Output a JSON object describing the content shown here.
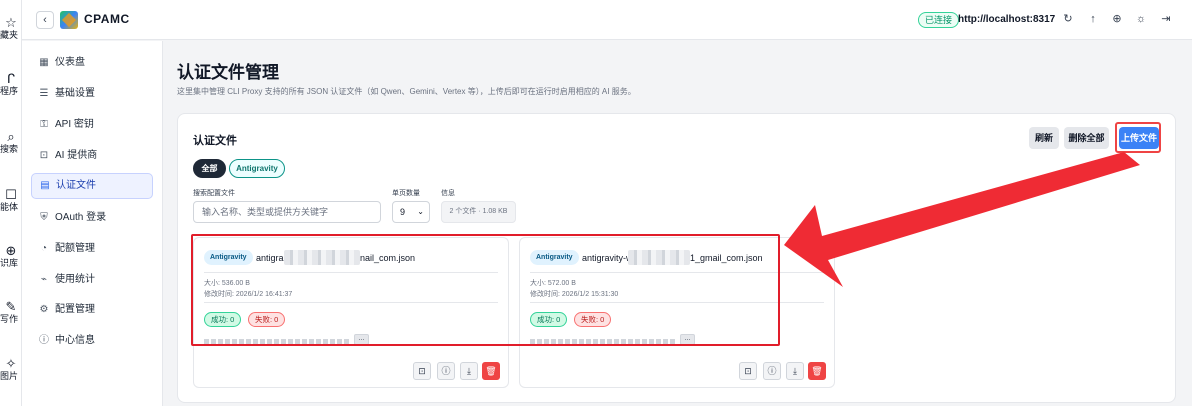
{
  "rail": [
    {
      "icon": "star-icon",
      "glyph": "☆",
      "label": "藏夹"
    },
    {
      "icon": "path-icon",
      "glyph": "ᒋ",
      "label": "程序"
    },
    {
      "icon": "search-icon",
      "glyph": "⌕",
      "label": "搜索"
    },
    {
      "icon": "robot-icon",
      "glyph": "☐",
      "label": "能体"
    },
    {
      "icon": "plus-circle-icon",
      "glyph": "⊕",
      "label": "识库"
    },
    {
      "icon": "pen-icon",
      "glyph": "✎",
      "label": "写作"
    },
    {
      "icon": "sparkle-icon",
      "glyph": "✧",
      "label": "图片"
    }
  ],
  "header": {
    "back_glyph": "‹",
    "app_name": "CPAMC",
    "status": "已连接",
    "url": "http://localhost:8317",
    "icons": [
      {
        "name": "refresh-icon",
        "glyph": "↻"
      },
      {
        "name": "upload-icon",
        "glyph": "↑"
      },
      {
        "name": "globe-icon",
        "glyph": "⊕"
      },
      {
        "name": "theme-sun-icon",
        "glyph": "☼"
      },
      {
        "name": "logout-icon",
        "glyph": "⇥"
      }
    ]
  },
  "sidebar": {
    "items": [
      {
        "label": "仪表盘",
        "glyph": "▦",
        "icon": "dashboard-icon"
      },
      {
        "label": "基础设置",
        "glyph": "☰",
        "icon": "sliders-icon"
      },
      {
        "label": "API 密钥",
        "glyph": "⚿",
        "icon": "key-icon"
      },
      {
        "label": "AI 提供商",
        "glyph": "⊡",
        "icon": "bot-icon"
      },
      {
        "label": "认证文件",
        "glyph": "▤",
        "icon": "file-icon"
      },
      {
        "label": "OAuth 登录",
        "glyph": "⛨",
        "icon": "shield-icon"
      },
      {
        "label": "配额管理",
        "glyph": "◔",
        "icon": "gauge-icon"
      },
      {
        "label": "使用统计",
        "glyph": "⌁",
        "icon": "chart-icon"
      },
      {
        "label": "配置管理",
        "glyph": "⚙",
        "icon": "gear-icon"
      },
      {
        "label": "中心信息",
        "glyph": "ⓘ",
        "icon": "info-icon"
      }
    ]
  },
  "page": {
    "title": "认证文件管理",
    "description": "这里集中管理 CLI Proxy 支持的所有 JSON 认证文件（如 Qwen、Gemini、Vertex 等），上传后即可在运行时启用相应的 AI 服务。"
  },
  "panel": {
    "title": "认证文件",
    "refresh": "刷新",
    "delete_all": "删除全部",
    "upload": "上传文件",
    "filters": [
      "全部",
      "Antigravity"
    ],
    "search_label": "搜索配置文件",
    "search_placeholder": "输入名称、类型或提供方关键字",
    "page_size_label": "单页数量",
    "page_size": "9",
    "page_size_chevron": "⌄",
    "info_label": "信息",
    "info_value": "2 个文件 · 1.08 KB"
  },
  "cards": [
    {
      "tag": "Antigravity",
      "name_start": "antigra",
      "name_end": "nail_com.json",
      "size": "大小: 536.00 B",
      "modified": "修改时间: 2026/1/2 16:41:37",
      "success": "成功: 0",
      "failure": "失败: 0",
      "more": "..."
    },
    {
      "tag": "Antigravity",
      "name_start": "antigravity-w",
      "name_end": "1_gmail_com.json",
      "size": "大小: 572.00 B",
      "modified": "修改时间: 2026/1/2 15:31:30",
      "success": "成功: 0",
      "failure": "失败: 0",
      "more": "..."
    }
  ],
  "card_actions": [
    {
      "name": "model-bot-icon",
      "glyph": "⊡"
    },
    {
      "name": "info-icon",
      "glyph": "ⓘ"
    },
    {
      "name": "download-icon",
      "glyph": "⤓"
    },
    {
      "name": "trash-icon",
      "glyph": "🗑"
    }
  ],
  "colors": {
    "accent": "#3b82f6",
    "annotation_red": "#e11d2a",
    "success": "#047857",
    "danger": "#ef4444"
  }
}
